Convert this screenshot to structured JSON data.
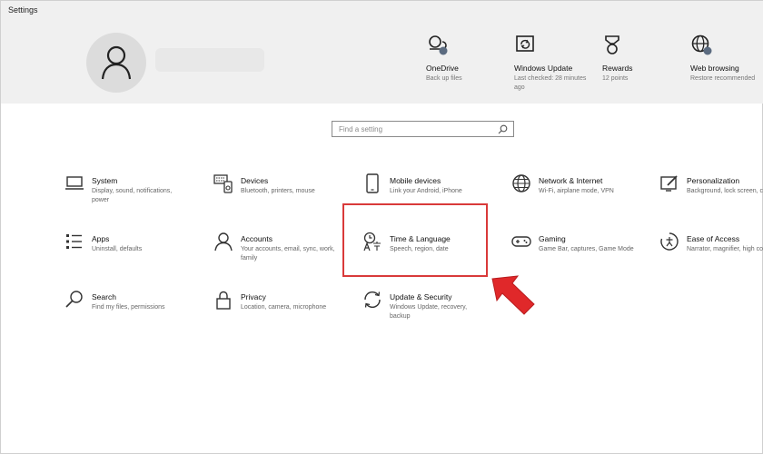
{
  "window": {
    "title": "Settings"
  },
  "header": {
    "quick_links": [
      {
        "icon": "cloud-icon",
        "title": "OneDrive",
        "subtitle": "Back up files"
      },
      {
        "icon": "sync-icon",
        "title": "Windows Update",
        "subtitle": "Last checked: 28 minutes ago"
      },
      {
        "icon": "rewards-icon",
        "title": "Rewards",
        "subtitle": "12 points"
      },
      {
        "icon": "globe-icon",
        "title": "Web browsing",
        "subtitle": "Restore recommended"
      }
    ]
  },
  "search": {
    "placeholder": "Find a setting"
  },
  "categories": [
    {
      "icon": "laptop-icon",
      "name": "System",
      "desc": "Display, sound, notifications, power"
    },
    {
      "icon": "keyboard-icon",
      "name": "Devices",
      "desc": "Bluetooth, printers, mouse"
    },
    {
      "icon": "phone-icon",
      "name": "Mobile devices",
      "desc": "Link your Android, iPhone"
    },
    {
      "icon": "globe-icon",
      "name": "Network & Internet",
      "desc": "Wi-Fi, airplane mode, VPN"
    },
    {
      "icon": "paint-icon",
      "name": "Personalization",
      "desc": "Background, lock screen, colors"
    },
    {
      "icon": "apps-icon",
      "name": "Apps",
      "desc": "Uninstall, defaults"
    },
    {
      "icon": "person-icon",
      "name": "Accounts",
      "desc": "Your accounts, email, sync, work, family"
    },
    {
      "icon": "time-language-icon",
      "name": "Time & Language",
      "desc": "Speech, region, date"
    },
    {
      "icon": "gamepad-icon",
      "name": "Gaming",
      "desc": "Game Bar, captures, Game Mode"
    },
    {
      "icon": "ease-of-access-icon",
      "name": "Ease of Access",
      "desc": "Narrator, magnifier, high contrast"
    },
    {
      "icon": "search-icon",
      "name": "Search",
      "desc": "Find my files, permissions"
    },
    {
      "icon": "lock-icon",
      "name": "Privacy",
      "desc": "Location, camera, microphone"
    },
    {
      "icon": "update-icon",
      "name": "Update & Security",
      "desc": "Windows Update, recovery, backup"
    }
  ],
  "annotation": {
    "color": "#d93a3a",
    "target": "Time & Language"
  }
}
